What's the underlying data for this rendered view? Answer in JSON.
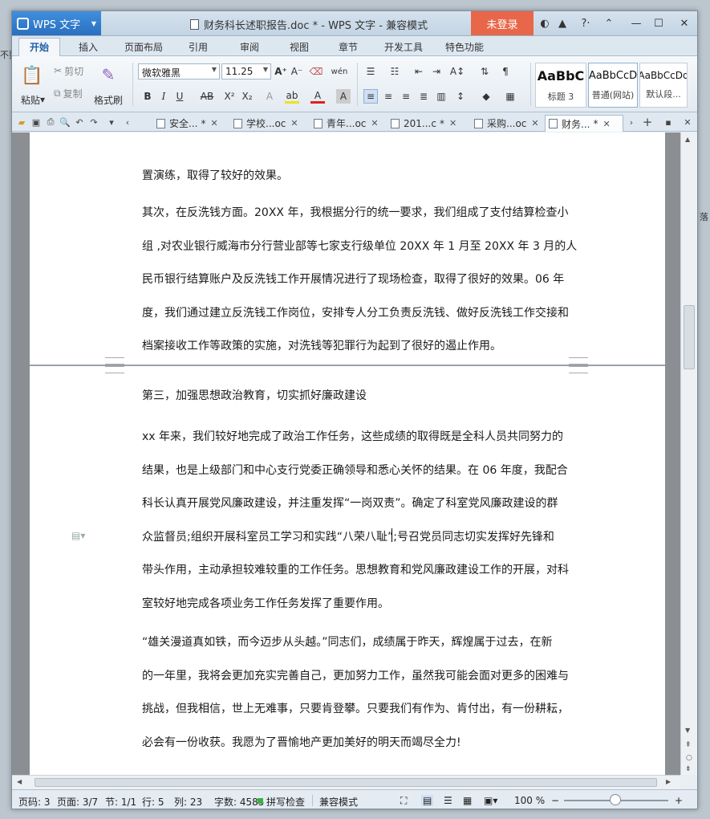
{
  "window": {
    "app_name": "WPS 文字",
    "title": "财务科长述职报告.doc * - WPS 文字 - 兼容模式",
    "login_label": "未登录"
  },
  "menu_tabs": [
    "开始",
    "插入",
    "页面布局",
    "引用",
    "审阅",
    "视图",
    "章节",
    "开发工具",
    "特色功能"
  ],
  "ribbon": {
    "paste": "粘贴",
    "cut": "剪切",
    "copy": "复制",
    "format_painter": "格式刷",
    "font_name": "微软雅黑",
    "font_size": "11.25",
    "styles": [
      {
        "sample": "AaBbC",
        "name": "标题 3"
      },
      {
        "sample": "AaBbCcD",
        "name": "普通(网站)"
      },
      {
        "sample": "AaBbCcDd",
        "name": "默认段..."
      }
    ]
  },
  "doc_tabs": [
    {
      "label": "安全...",
      "modified": "*"
    },
    {
      "label": "学校...oc",
      "modified": ""
    },
    {
      "label": "青年...oc",
      "modified": ""
    },
    {
      "label": "201...c",
      "modified": "*"
    },
    {
      "label": "采购...oc",
      "modified": ""
    },
    {
      "label": "财务...",
      "modified": "*",
      "active": true
    }
  ],
  "document": {
    "top_page_lines": [
      "置演练，取得了较好的效果。"
    ],
    "para_anti_money": [
      "其次，在反洗钱方面。20XX 年，我根据分行的统一要求，我们组成了支付结算检查小",
      "组 ,对农业银行威海市分行营业部等七家支行级单位 20XX 年 1 月至 20XX 年 3 月的人",
      "民币银行结算账户及反洗钱工作开展情况进行了现场检查，取得了很好的效果。06 年",
      "度，我们通过建立反洗钱工作岗位，安排专人分工负责反洗钱、做好反洗钱工作交接和",
      "档案接收工作等政策的实施，对洗钱等犯罪行为起到了很好的遏止作用。"
    ],
    "heading_three": "第三，加强思想政治教育，切实抓好廉政建设",
    "para_politics": [
      "xx 年来，我们较好地完成了政治工作任务，这些成绩的取得既是全科人员共同努力的",
      "结果，也是上级部门和中心支行党委正确领导和悉心关怀的结果。在 06 年度，我配合",
      "科长认真开展党风廉政建设，并注重发挥“一岗双责”。确定了科室党风廉政建设的群",
      "众监督员;组织开展科室员工学习和实践“八荣八耻”;号召党员同志切实发挥好先锋和",
      "带头作用，主动承担较难较重的工作任务。思想教育和党风廉政建设工作的开展，对科",
      "室较好地完成各项业务工作任务发挥了重要作用。"
    ],
    "para_closing": [
      "“雄关漫道真如铁，而今迈步从头越。”同志们，成绩属于昨天，辉煌属于过去，在新",
      "的一年里，我将会更加充实完善自己，更加努力工作，虽然我可能会面对更多的困难与",
      "挑战，但我相信，世上无难事，只要肯登攀。只要我们有作为、肯付出，有一份耕耘，",
      "必会有一份收获。我愿为了晋愉地产更加美好的明天而竭尽全力!"
    ]
  },
  "status": {
    "page_num": "页码: 3",
    "pages": "页面: 3/7",
    "section": "节: 1/1",
    "row": "行: 5",
    "col": "列: 23",
    "word_count": "字数: 4585",
    "spellcheck": "拼写检查",
    "compat_mode": "兼容模式",
    "zoom": "100 %",
    "zoom_level_percent": 100
  },
  "colors": {
    "accent": "#2a6fc0",
    "login": "#e8674a",
    "spellcheck_dot": "#3cb043"
  }
}
